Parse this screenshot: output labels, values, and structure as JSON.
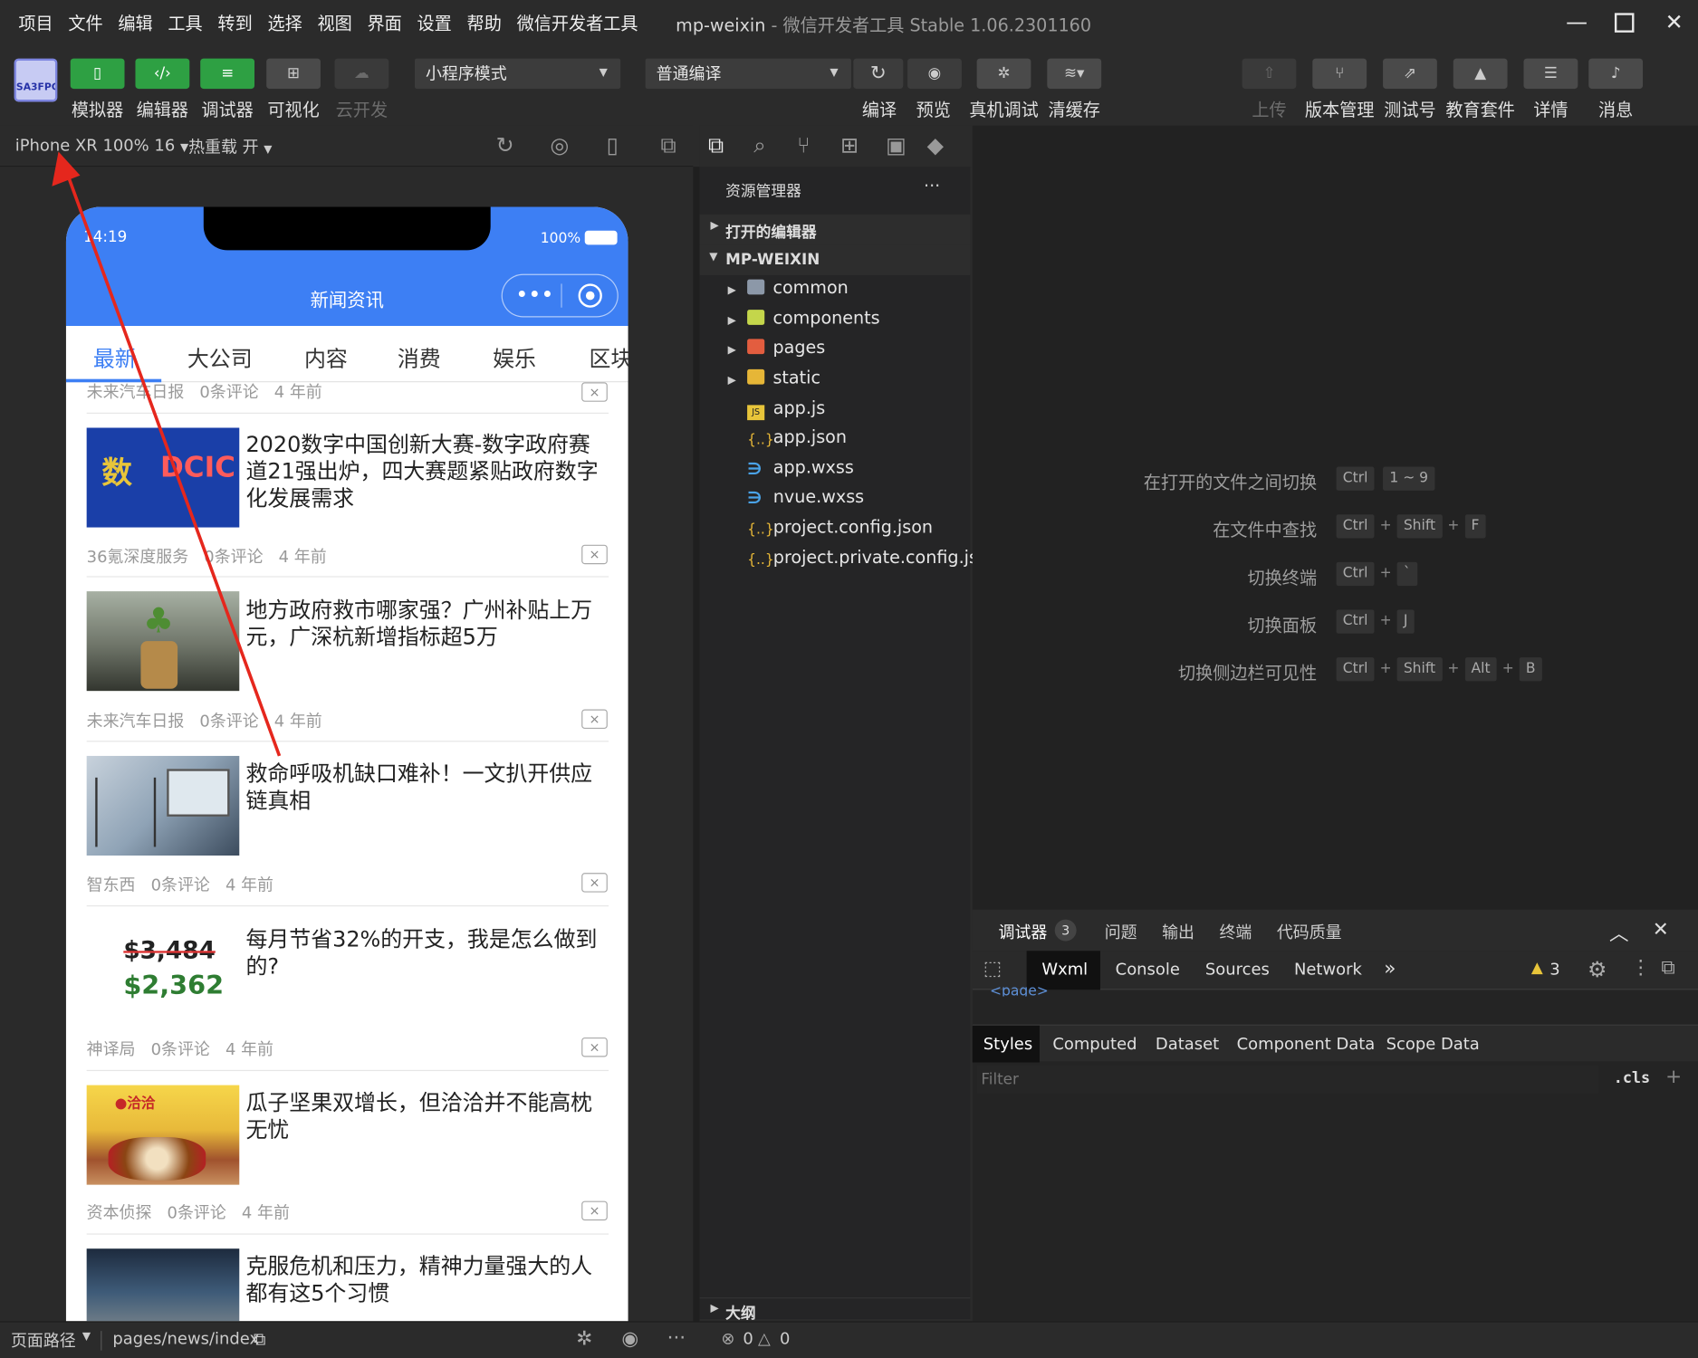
{
  "menubar": {
    "items": [
      "项目",
      "文件",
      "编辑",
      "工具",
      "转到",
      "选择",
      "视图",
      "界面",
      "设置",
      "帮助",
      "微信开发者工具"
    ],
    "project_name": "mp-weixin",
    "app_title": " - 微信开发者工具 Stable 1.06.2301160"
  },
  "toolbar": {
    "logo_text": "SA3FPC",
    "buttons": [
      {
        "label": "模拟器",
        "icon": "phone-icon"
      },
      {
        "label": "编辑器",
        "icon": "code-icon"
      },
      {
        "label": "调试器",
        "icon": "debug-icon"
      },
      {
        "label": "可视化",
        "icon": "layout-icon"
      },
      {
        "label": "云开发",
        "icon": "cloud-icon"
      }
    ],
    "mode_select": "小程序模式",
    "compile_select": "普通编译",
    "actions": [
      "编译",
      "预览",
      "真机调试",
      "清缓存"
    ],
    "right_actions": [
      "上传",
      "版本管理",
      "测试号",
      "教育套件",
      "详情",
      "消息"
    ]
  },
  "simulator": {
    "device": "iPhone XR 100% 16",
    "hot_reload": "热重载 开",
    "status_time": "14:19",
    "battery": "100%",
    "nav_title": "新闻资讯",
    "tabs": [
      "最新",
      "大公司",
      "内容",
      "消费",
      "娱乐",
      "区块"
    ],
    "active_tab": "最新",
    "partial_meta": [
      "未来汽车日报",
      "0条评论",
      "4 年前"
    ],
    "news": [
      {
        "title": "2020数字中国创新大赛-数字政府赛道21强出炉，四大赛题紧贴政府数字化发展需求",
        "source": "36氪深度服务",
        "comments": "0条评论",
        "time": "4 年前",
        "thumb_text": "DCIC"
      },
      {
        "title": "地方政府救市哪家强？广州补贴上万元，广深杭新增指标超5万",
        "source": "未来汽车日报",
        "comments": "0条评论",
        "time": "4 年前",
        "thumb_text": ""
      },
      {
        "title": "救命呼吸机缺口难补！一文扒开供应链真相",
        "source": "智东西",
        "comments": "0条评论",
        "time": "4 年前",
        "thumb_text": ""
      },
      {
        "title": "每月节省32%的开支，我是怎么做到的?",
        "source": "神译局",
        "comments": "0条评论",
        "time": "4 年前",
        "thumb_text": "$3,484|$2,362"
      },
      {
        "title": "瓜子坚果双增长，但洽洽并不能高枕无忧",
        "source": "资本侦探",
        "comments": "0条评论",
        "time": "4 年前",
        "thumb_text": "洽洽"
      },
      {
        "title": "克服危机和压力，精神力量强大的人都有这5个习惯",
        "source": "",
        "comments": "",
        "time": "",
        "thumb_text": ""
      }
    ],
    "close_label": "×"
  },
  "explorer": {
    "title": "资源管理器",
    "more": "···",
    "open_editors": "打开的编辑器",
    "root": "MP-WEIXIN",
    "folders": [
      "common",
      "components",
      "pages",
      "static"
    ],
    "files": [
      {
        "name": "app.js",
        "type": "js"
      },
      {
        "name": "app.json",
        "type": "json"
      },
      {
        "name": "app.wxss",
        "type": "css"
      },
      {
        "name": "nvue.wxss",
        "type": "css"
      },
      {
        "name": "project.config.json",
        "type": "json"
      },
      {
        "name": "project.private.config.js...",
        "type": "json"
      }
    ],
    "outline": "大纲"
  },
  "shortcuts": [
    {
      "label": "在打开的文件之间切换",
      "keys": [
        "Ctrl",
        "1 ~ 9"
      ]
    },
    {
      "label": "在文件中查找",
      "keys": [
        "Ctrl",
        "Shift",
        "F"
      ]
    },
    {
      "label": "切换终端",
      "keys": [
        "Ctrl",
        "`"
      ]
    },
    {
      "label": "切换面板",
      "keys": [
        "Ctrl",
        "J"
      ]
    },
    {
      "label": "切换侧边栏可见性",
      "keys": [
        "Ctrl",
        "Shift",
        "Alt",
        "B"
      ]
    }
  ],
  "devtools": {
    "tabs": [
      "调试器",
      "问题",
      "输出",
      "终端",
      "代码质量"
    ],
    "debugger_badge": "3",
    "inspector_tabs": [
      "Wxml",
      "Console",
      "Sources",
      "Network"
    ],
    "more_tabs": "»",
    "warnings": "3",
    "page_tag": "<page>",
    "style_tabs": [
      "Styles",
      "Computed",
      "Dataset",
      "Component Data",
      "Scope Data"
    ],
    "filter_placeholder": "Filter",
    "cls": ".cls",
    "add": "+"
  },
  "statusbar": {
    "page_path_label": "页面路径",
    "page_path": "pages/news/index",
    "errors": "0",
    "warnings": "0"
  },
  "colors": {
    "accent_green": "#2ea043",
    "nav_blue": "#3d7ff4",
    "annotation_red": "#e5271d"
  }
}
